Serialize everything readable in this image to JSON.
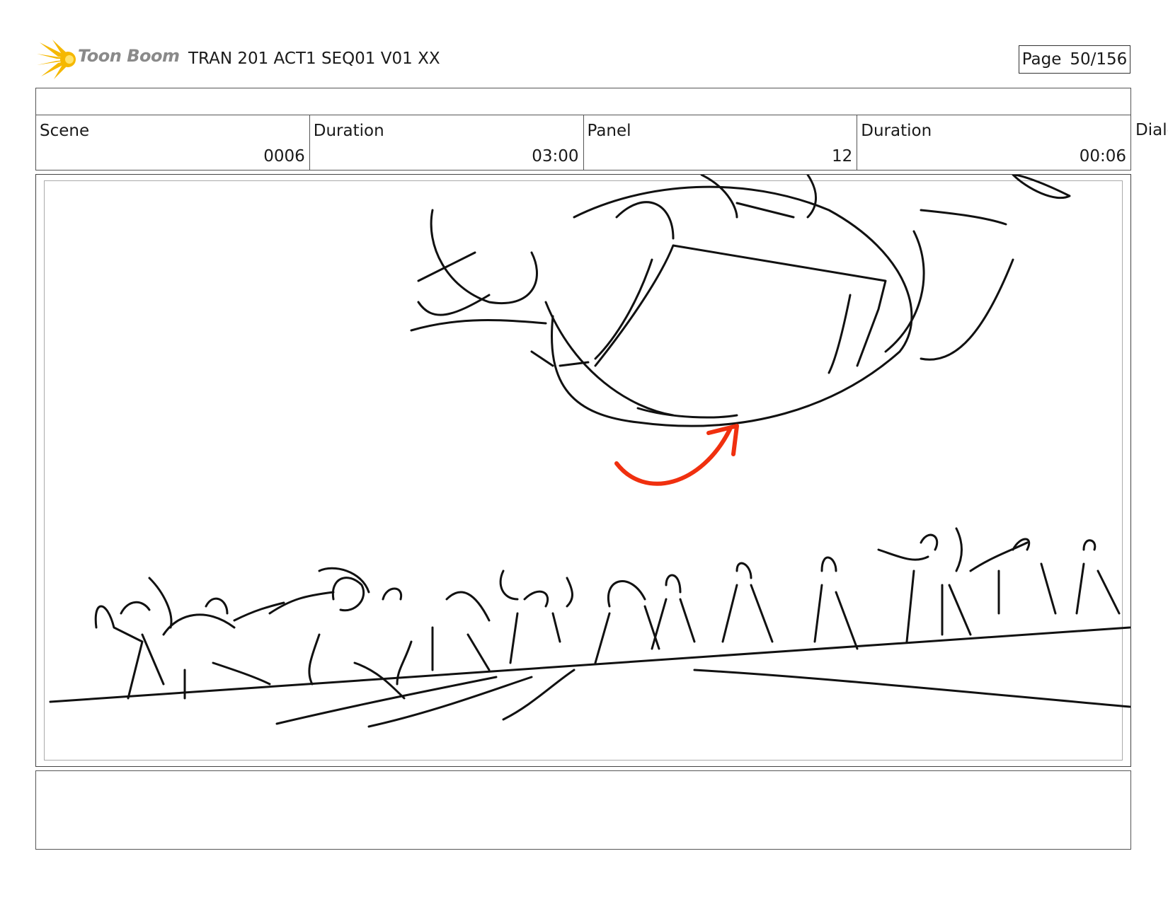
{
  "header": {
    "logo_text": "Toon Boom",
    "logo_color": "#f5b800",
    "title": "TRAN 201 ACT1 SEQ01 V01 XX",
    "page_label": "Page",
    "page_value": "50/156"
  },
  "info": {
    "scene_label": "Scene",
    "scene_value": "0006",
    "scene_duration_label": "Duration",
    "scene_duration_value": "03:00",
    "panel_label": "Panel",
    "panel_value": "12",
    "panel_duration_label": "Duration",
    "panel_duration_value": "00:06",
    "dialog_label": "Dialo"
  },
  "sketch": {
    "line_color": "#111111",
    "arrow_color": "#f0300f"
  }
}
